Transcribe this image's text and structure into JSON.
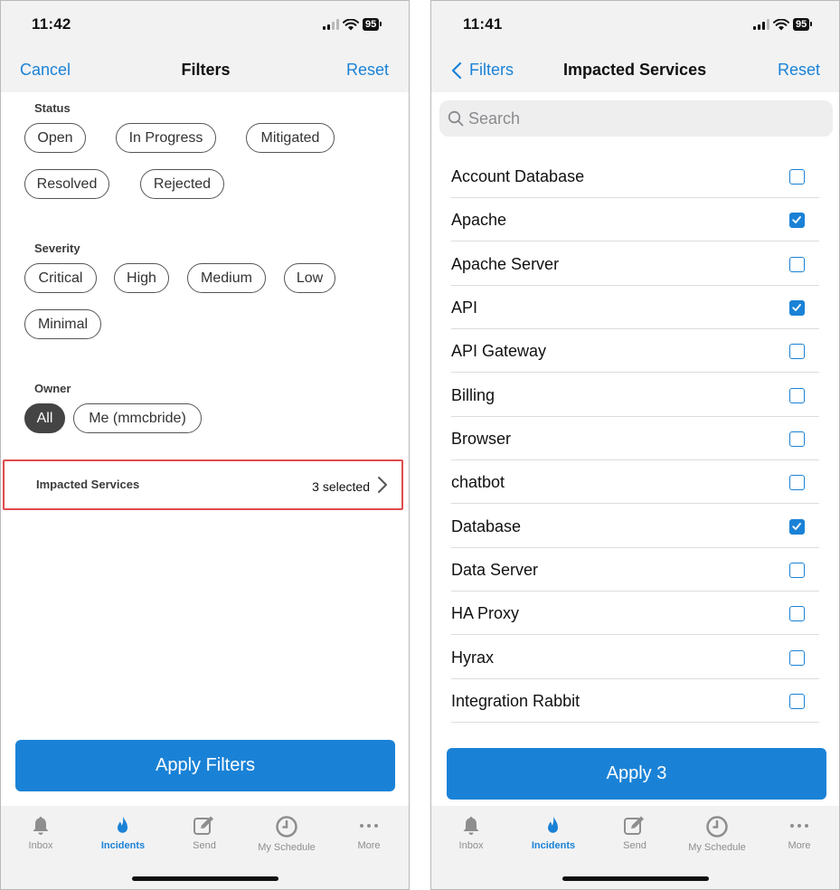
{
  "left": {
    "status": {
      "time": "11:42",
      "battery": "95"
    },
    "nav": {
      "cancel": "Cancel",
      "title": "Filters",
      "reset": "Reset"
    },
    "status_filter": {
      "label": "Status",
      "chips": [
        "Open",
        "In Progress",
        "Mitigated",
        "Resolved",
        "Rejected"
      ]
    },
    "severity_filter": {
      "label": "Severity",
      "chips": [
        "Critical",
        "High",
        "Medium",
        "Low",
        "Minimal"
      ]
    },
    "owner_filter": {
      "label": "Owner",
      "chips": [
        "All",
        "Me (mmcbride)"
      ],
      "selected": "All"
    },
    "impacted_services": {
      "label": "Impacted Services",
      "value": "3 selected"
    },
    "apply_label": "Apply Filters"
  },
  "right": {
    "status": {
      "time": "11:41",
      "battery": "95"
    },
    "nav": {
      "back": "Filters",
      "title": "Impacted Services",
      "reset": "Reset"
    },
    "search": {
      "placeholder": "Search",
      "value": ""
    },
    "services": [
      {
        "name": "Account Database",
        "checked": false
      },
      {
        "name": "Apache",
        "checked": true
      },
      {
        "name": "Apache Server",
        "checked": false
      },
      {
        "name": "API",
        "checked": true
      },
      {
        "name": "API Gateway",
        "checked": false
      },
      {
        "name": "Billing",
        "checked": false
      },
      {
        "name": "Browser",
        "checked": false
      },
      {
        "name": "chatbot",
        "checked": false
      },
      {
        "name": "Database",
        "checked": true
      },
      {
        "name": "Data Server",
        "checked": false
      },
      {
        "name": "HA Proxy",
        "checked": false
      },
      {
        "name": "Hyrax",
        "checked": false
      },
      {
        "name": "Integration Rabbit",
        "checked": false
      }
    ],
    "apply_label": "Apply 3"
  },
  "tabbar": {
    "tabs": [
      {
        "label": "Inbox",
        "icon": "bell-icon",
        "active": false
      },
      {
        "label": "Incidents",
        "icon": "flame-icon",
        "active": true
      },
      {
        "label": "Send",
        "icon": "compose-icon",
        "active": false
      },
      {
        "label": "My Schedule",
        "icon": "clock-icon",
        "active": false
      },
      {
        "label": "More",
        "icon": "ellipsis-icon",
        "active": false
      }
    ]
  },
  "colors": {
    "accent": "#1a82d6",
    "highlight_border": "#e04b4b",
    "header_bg": "#f2f2f3",
    "selected_chip": "#444444"
  }
}
